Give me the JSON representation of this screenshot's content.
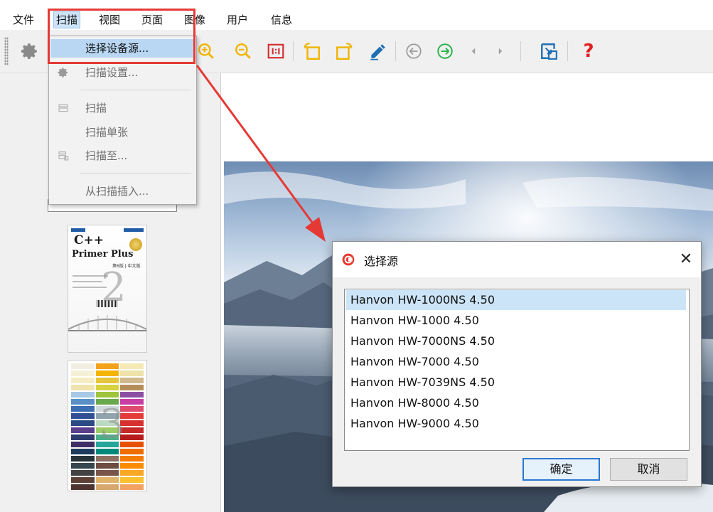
{
  "menubar": {
    "items": [
      {
        "label": "文件"
      },
      {
        "label": "扫描"
      },
      {
        "label": "视图"
      },
      {
        "label": "页面"
      },
      {
        "label": "图像"
      },
      {
        "label": "用户"
      },
      {
        "label": "信息"
      }
    ],
    "active_item": "扫描"
  },
  "toolbar": {
    "icons": [
      "gear-icon",
      "zoom-in-icon",
      "zoom-out-icon",
      "actual-size-icon",
      "rotate-left-icon",
      "rotate-right-icon",
      "edit-pen-icon",
      "prev-circle-icon",
      "next-circle-icon",
      "prev-page-icon",
      "next-page-icon",
      "export-icon",
      "help-icon"
    ],
    "help_label": "?"
  },
  "scan_menu": {
    "items": [
      {
        "label": "选择设备源...",
        "icon": "none",
        "state": "highlighted"
      },
      {
        "label": "扫描设置...",
        "icon": "gear-icon",
        "state": "enabled"
      },
      {
        "label": "扫描",
        "icon": "scanner-icon",
        "state": "enabled"
      },
      {
        "label": "扫描单张",
        "icon": "none",
        "state": "enabled"
      },
      {
        "label": "扫描至...",
        "icon": "scan-to-icon",
        "state": "enabled"
      },
      {
        "label": "从扫描插入...",
        "icon": "none",
        "state": "enabled"
      }
    ]
  },
  "thumbnails": [
    {
      "page_number": "2",
      "cover_title_1": "C++",
      "cover_title_2": "Primer Plus",
      "cover_edition": "第6版 | 中文版"
    },
    {
      "page_number": "3"
    }
  ],
  "dialog": {
    "title": "选择源",
    "close_glyph": "✕",
    "sources": [
      "Hanvon HW-1000NS 4.50",
      "Hanvon HW-1000 4.50",
      "Hanvon HW-7000NS 4.50",
      "Hanvon HW-7000 4.50",
      "Hanvon HW-7039NS 4.50",
      "Hanvon HW-8000 4.50",
      "Hanvon HW-9000 4.50"
    ],
    "selected_source": "Hanvon HW-1000NS 4.50",
    "ok_label": "确定",
    "cancel_label": "取消"
  },
  "colors": {
    "highlight_red": "#e53935",
    "selection_blue": "#cce4f7",
    "toolbar_yellow": "#f0b400",
    "toolbar_green": "#2bb24c",
    "toolbar_blue": "#1f6fb5"
  }
}
